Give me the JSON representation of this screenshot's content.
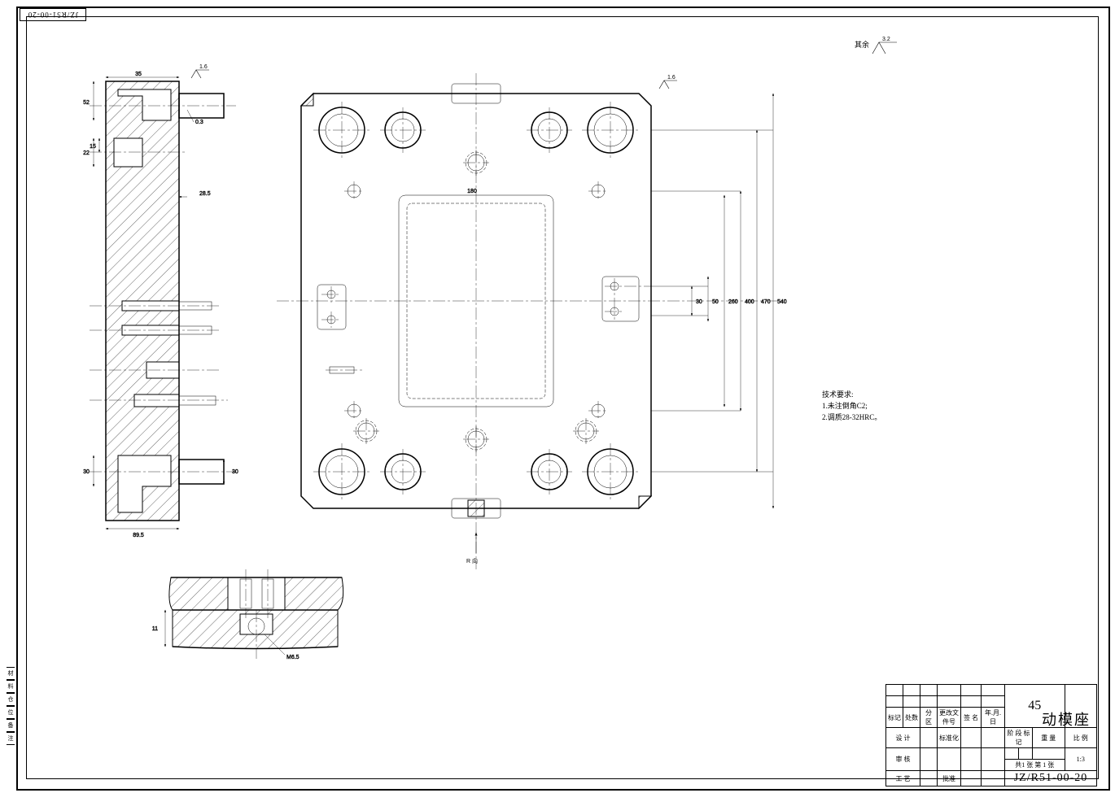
{
  "part_number": "JZ/R51-00-20",
  "part_number_box": "JZ/R51-00-20",
  "title_block": {
    "material": "45",
    "name": "动模座",
    "dwg_no": "JZ/R51-00-20",
    "stage_mark": "阶 段 标 记",
    "weight": "重 量",
    "scale": "比 例",
    "scale_val": "1:3",
    "sheet": "共1  张   第   1 张",
    "rows": {
      "mark": "标记",
      "dept": "处数",
      "zone": "分 区",
      "file": "更改文件号",
      "sign": "签 名",
      "date": "年.月.日",
      "design": "设 计",
      "std": "标准化",
      "check": "审 核",
      "craft": "工 艺",
      "appr": "批准"
    }
  },
  "left_tabs": [
    "材",
    "料",
    "仓",
    "位",
    "备",
    "注"
  ],
  "tech_req": {
    "title": "技术要求:",
    "l1": "1.未注倒角C2;",
    "l2": "2.调质28-32HRC。"
  },
  "rest_label": "其余",
  "rest_val": "3.2",
  "view_label": "R 向",
  "surfaces": {
    "s16a": "1.6",
    "s16b": "1.6",
    "s16c": "1.6"
  },
  "side_dims": {
    "d35": "35",
    "d52": "52",
    "d22": "22",
    "d15": "15",
    "d285": "28.5",
    "d30a": "30",
    "d895": "89.5",
    "d03": "0.3",
    "d30b": "30"
  },
  "front_dims": {
    "d180": "180",
    "d400": "400",
    "d470": "470",
    "d540": "540",
    "d30": "30",
    "d50": "50",
    "d260": "260"
  },
  "detail_dims": {
    "d11": "11",
    "dm65": "M6.5"
  }
}
